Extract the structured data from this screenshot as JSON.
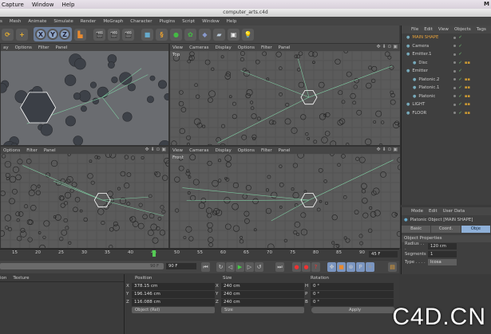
{
  "mac_menu": [
    "Capture",
    "Window",
    "Help"
  ],
  "window_title": "computer_arts.c4d",
  "app_menu": [
    "s",
    "Mesh",
    "Animate",
    "Simulate",
    "Render",
    "MoGraph",
    "Character",
    "Plugins",
    "Script",
    "Window",
    "Help"
  ],
  "toolbar": {
    "axis_x": "X",
    "axis_y": "Y",
    "axis_z": "Z"
  },
  "viewports": {
    "perspective": {
      "menu": [
        "ay",
        "Options",
        "Filter",
        "Panel"
      ]
    },
    "top": {
      "menu": [
        "View",
        "Cameras",
        "Display",
        "Options",
        "Filter",
        "Panel"
      ],
      "label": "Top"
    },
    "bottom_left": {
      "menu": [
        "Options",
        "Filter",
        "Panel"
      ]
    },
    "front": {
      "menu": [
        "View",
        "Cameras",
        "Display",
        "Options",
        "Filter",
        "Panel"
      ],
      "label": "Front"
    }
  },
  "object_manager": {
    "menu": [
      "File",
      "Edit",
      "View",
      "Objects",
      "Tags"
    ],
    "objects": [
      {
        "name": "MAIN SHAPE",
        "level": 0,
        "color": "#e8a23a"
      },
      {
        "name": "Camera",
        "level": 0
      },
      {
        "name": "Emitter.1",
        "level": 0
      },
      {
        "name": "Disc",
        "level": 1
      },
      {
        "name": "Emitter",
        "level": 0
      },
      {
        "name": "Platonic.2",
        "level": 1
      },
      {
        "name": "Platonic.1",
        "level": 1
      },
      {
        "name": "Platonic",
        "level": 1
      },
      {
        "name": "LIGHT",
        "level": 0
      },
      {
        "name": "FLOOR",
        "level": 0
      }
    ]
  },
  "attribute_manager": {
    "menu": [
      "Mode",
      "Edit",
      "User Data"
    ],
    "object_title": "Platonic Object [MAIN SHAPE]",
    "tabs": [
      "Basic",
      "Coord.",
      "Obje"
    ],
    "active_tab": 2,
    "section": "Object Properties",
    "radius_label": "Radius . . .",
    "radius": "120 cm",
    "segments_label": "Segments",
    "segments": "1",
    "type_label": "Type . . . .",
    "type": "Icosa"
  },
  "timeline": {
    "ticks": [
      "15",
      "20",
      "25",
      "30",
      "35",
      "40",
      "45",
      "50",
      "55",
      "60",
      "65",
      "70",
      "75",
      "80",
      "85",
      "90"
    ],
    "current": "45",
    "current_frame": "45 F"
  },
  "playback": {
    "end_frame_slider": "90 F",
    "end_frame": "90 F"
  },
  "materials": {
    "menu": [
      "ion",
      "Texture"
    ]
  },
  "coordinates": {
    "headers": [
      "Position",
      "Size",
      "Rotation"
    ],
    "pos_labels": [
      "X",
      "Y",
      "Z"
    ],
    "position": [
      "378.15 cm",
      "196.146 cm",
      "116.088 cm"
    ],
    "size_labels": [
      "X",
      "Y",
      "Z"
    ],
    "size": [
      "240 cm",
      "240 cm",
      "240 cm"
    ],
    "rot_labels": [
      "H",
      "P",
      "B"
    ],
    "rotation": [
      "0 °",
      "0 °",
      "0 °"
    ],
    "mode": "Object (Rel)",
    "size_mode": "Size",
    "apply": "Apply"
  },
  "watermark": "C4D.CN",
  "logo": "M"
}
